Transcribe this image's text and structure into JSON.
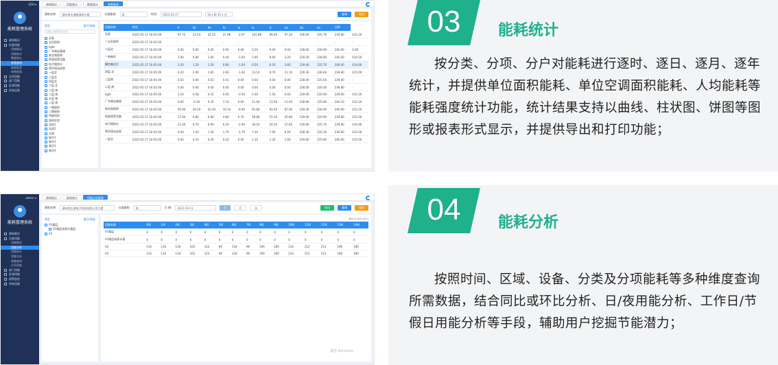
{
  "app": {
    "system_name": "能耗管理系统",
    "user1": "SZH ▾",
    "user2": "admin ▾"
  },
  "menu1": [
    "建筑概况",
    "负载用能",
    "用能概况",
    "用能统计",
    "数据统计",
    "参数查询",
    "能耗报表",
    "参数图表",
    "分项用能",
    "部门用能",
    "区域用能",
    "系统运维"
  ],
  "menu1_active": 5,
  "menu2": [
    "建筑概况",
    "负载用能",
    "用能概况",
    "用能分析",
    "用能统计",
    "用能分析",
    "参数查询",
    "分项用能",
    "部门用能",
    "区域用能",
    "报警监控",
    "系统运维"
  ],
  "menu2_active": 3,
  "shot1": {
    "tabs": [
      "建筑概况",
      "用能统计",
      "数据统计",
      "参数查询"
    ],
    "active_tab": 3,
    "filter": {
      "building_label": "建筑名称:",
      "building_value": "湖州南太湖能源网大楼",
      "category_label": "分类能耗:",
      "category_value": "电",
      "time_label": "时间:",
      "date_value": "2022-05-17",
      "hour_value": "16 ▾ 时 45 ▾ 分",
      "query": "查询",
      "export": "导出"
    },
    "tree": {
      "title": "类型",
      "toggle": "展开/收起",
      "search": "请输入关键字进行过滤",
      "items": [
        "总表",
        "全员照明",
        "light",
        "厂车辆走廊梯",
        "南北侧照明",
        "地面接受设备",
        "电子楼热水",
        "荣环境动态表",
        "一层北",
        "二层北",
        "四层北",
        "三层 北",
        "二层 南",
        "三层 南",
        "五层 南",
        "入层 南",
        "一期厨房",
        "二期厨房",
        "特厨机房",
        "照明实验",
        "风机1",
        "风机2",
        "光源",
        "制冷1",
        "制冷2",
        "制冷3",
        "制冷4"
      ]
    },
    "columns": [
      "回路名称",
      "时间",
      "P",
      "Pa",
      "Pb",
      "Pc",
      "Ia",
      "Ib",
      "Ic",
      "Ua",
      "Ub",
      "Uc",
      "功率"
    ],
    "rows": [
      [
        "总表",
        "2022-05-17 16:45:00",
        "97.72",
        "23.24",
        "32.52",
        "21.96",
        "-2.07",
        "101.88",
        "96.40",
        "97.20",
        "236.00",
        "235.70",
        "239.80",
        "414.20"
      ],
      [
        "└ 全员照明",
        "2022-05-17 16:45:00",
        "-",
        "-",
        "-",
        "-",
        "-",
        "-",
        "-",
        "-",
        "-",
        "-",
        "-",
        "-"
      ],
      [
        "  二层北",
        "2022-05-17 16:45:00",
        "0.00",
        "0.00",
        "0.00",
        "0.00",
        "0.00",
        "0.20",
        "0.00",
        "0.00",
        "238.00",
        "236.90",
        "240.00",
        "0.00"
      ],
      [
        "  └ 电梯间",
        "2022-05-17 16:45:00",
        "2.90",
        "0.84",
        "1.60",
        "0.40",
        "-1.00",
        "3.90",
        "8.90",
        "3.20",
        "239.30",
        "236.80",
        "240.00",
        "414.50"
      ],
      [
        "    播控偏边灯",
        "2022-05-17 16:45:00",
        "3.30",
        "1.20",
        "1.20",
        "0.80",
        "-1.00",
        "0.50",
        "6.10",
        "3.60",
        "239.40",
        "235.70",
        "240.00",
        "414.60"
      ],
      [
        "  四层 北",
        "2022-05-17 16:45:00",
        "6.20",
        "2.00",
        "1.60",
        "2.60",
        "-1.60",
        "13.10",
        "8.70",
        "11.10",
        "239.30",
        "236.60",
        "239.60",
        "415.00"
      ],
      [
        "  三层南",
        "2022-05-17 16:45:00",
        "0.02",
        "0.00",
        "0.02",
        "0.01",
        "0.00",
        "0.00",
        "0.00",
        "0.00",
        "238.00",
        "235.60",
        "239.00",
        "-"
      ],
      [
        "  二层 南",
        "2022-05-17 16:45:00",
        "0.00",
        "0.00",
        "0.00",
        "0.00",
        "0.00",
        "0.00",
        "0.00",
        "0.00",
        "238.00",
        "240.00",
        "239.80",
        "-"
      ],
      [
        "light",
        "2022-05-17 16:45:00",
        "1.10",
        "0.58",
        "0.52",
        "0.00",
        "-0.50",
        "2.00",
        "1.50",
        "0.00",
        "239.00",
        "235.90",
        "239.00",
        "415.20"
      ],
      [
        "厂车辆走廊梯",
        "2022-05-17 16:45:00",
        "0.60",
        "-0.20",
        "0.20",
        "1.10",
        "0.00",
        "11.60",
        "12.00",
        "11.40",
        "238.90",
        "235.80",
        "240.10",
        "415.20"
      ],
      [
        "南北侧照明",
        "2022-05-17 16:45:00",
        "56.90",
        "20.20",
        "20.50",
        "19.10",
        "-9.90",
        "91.80",
        "92.40",
        "87.90",
        "239.40",
        "236.00",
        "240.00",
        "415.20"
      ],
      [
        "地面接受设备",
        "2022-05-17 16:45:00",
        "17.60",
        "6.80",
        "6.80",
        "4.80",
        "0.70",
        "28.80",
        "25.10",
        "20.80",
        "239.00",
        "235.90",
        "239.80",
        "415.00"
      ],
      [
        "电子楼热水",
        "2022-05-17 16:45:00",
        "21.00",
        "6.70",
        "6.90",
        "6.20",
        "-2.90",
        "36.10",
        "26.50",
        "27.60",
        "239.00",
        "235.70",
        "239.80",
        "414.90"
      ],
      [
        "荣环境动态表",
        "2022-05-17 16:45:00",
        "4.40",
        "1.20",
        "1.30",
        "1.70",
        "-1.70",
        "7.20",
        "7.90",
        "9.20",
        "238.30",
        "235.30",
        "239.60",
        "415.00"
      ],
      [
        "一层北",
        "2022-05-17 16:45:00",
        "0.60",
        "0.10",
        "0.20",
        "0.20",
        "0.00",
        "1.10",
        "1.20",
        "1.60",
        "239.00",
        "235.80",
        "240.00",
        "415.00"
      ]
    ],
    "selected_row": 4
  },
  "shot2": {
    "tabs": [
      "建筑概况",
      "能效统计",
      "用能分析报表"
    ],
    "active_tab": 2,
    "filter": {
      "building_label": "建筑名称:",
      "building_value": "湖州南太湖电子科技有限公司大楼",
      "category_label": "分类能耗:",
      "category_value": "电",
      "date_label": "日 期:",
      "date_value": "2021-03-11",
      "mode1": "日",
      "mode2": "月",
      "mode3": "年",
      "export": "导出",
      "query": "查询",
      "extra": "导出"
    },
    "tree": {
      "title": "类型",
      "toggle": "展开/收起",
      "items": [
        "A1楼层",
        "A1楼层电表计量层",
        "A2"
      ]
    },
    "meta": "统计1天  总计: 820.9",
    "columns": [
      "回路名称",
      "0时",
      "1时",
      "2时",
      "3时",
      "4时",
      "5时",
      "6时",
      "7时",
      "8时",
      "9时",
      "10时",
      "11时",
      "12时",
      "13时",
      "14时"
    ],
    "rows": [
      [
        "A1楼层",
        "0",
        "0",
        "0",
        "0",
        "0",
        "0",
        "0",
        "0",
        "0",
        "0",
        "0",
        "0",
        "0",
        "0",
        "0"
      ],
      [
        "A1楼层电表计量",
        "0",
        "0",
        "0",
        "0",
        "0",
        "0",
        "0",
        "0",
        "0",
        "0",
        "0",
        "0",
        "0",
        "0",
        "0"
      ],
      [
        "A2",
        "110",
        "116",
        "118",
        "102",
        "124",
        "96",
        "134",
        "96",
        "190",
        "200",
        "214",
        "212",
        "213",
        "196",
        "180"
      ],
      [
        "A3",
        "110",
        "116",
        "118",
        "102",
        "124",
        "96",
        "134",
        "96",
        "190",
        "200",
        "214",
        "212",
        "213",
        "196",
        "180"
      ]
    ],
    "watermark": "激活 Windows"
  },
  "cards": [
    {
      "num": "03",
      "title": "能耗统计",
      "body": "按分类、分项、分户对能耗进行逐时、逐日、逐月、逐年统计，并提供单位面积能耗、单位空调面积能耗、人均能耗等能耗强度统计功能，统计结果支持以曲线、柱状图、饼图等图形或报表形式显示，并提供导出和打印功能；"
    },
    {
      "num": "04",
      "title": "能耗分析",
      "body": "按照时间、区域、设备、分类及分项能耗等多种维度查询所需数据，结合同比或环比分析、日/夜用能分析、工作日/节假日用能分析等手段，辅助用户挖掘节能潜力；"
    }
  ],
  "colors": {
    "nav": "#1f3157",
    "accent": "#2d8cf0",
    "badge": "#1fb08c",
    "orange": "#f39c12"
  }
}
